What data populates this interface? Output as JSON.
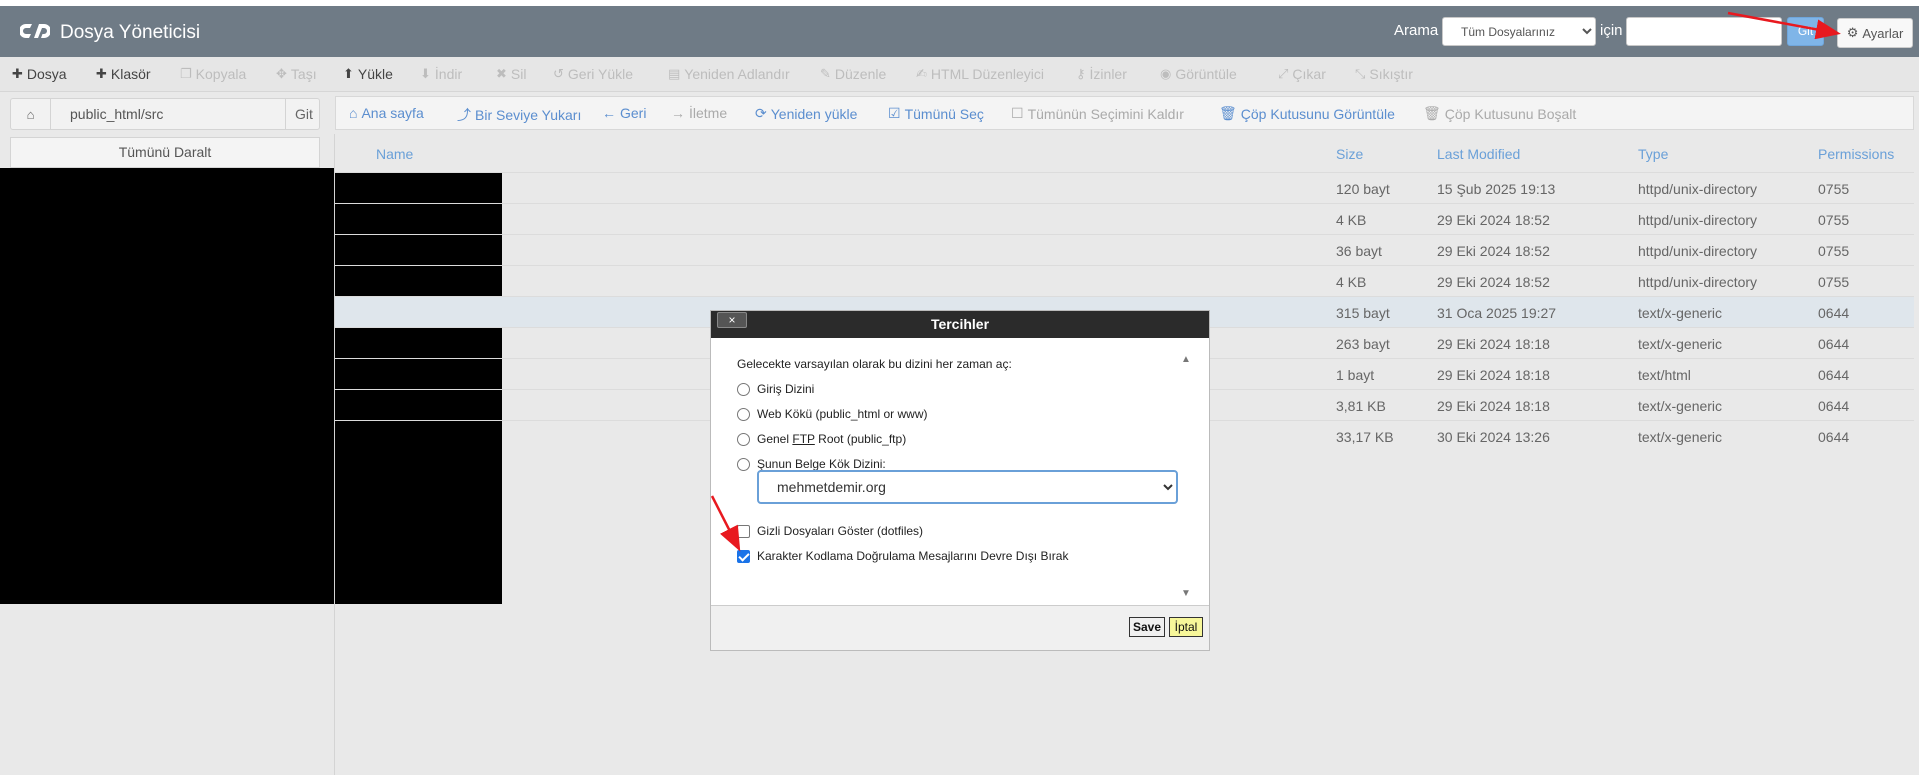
{
  "header": {
    "title": "Dosya Yöneticisi",
    "search_label": "Arama",
    "search_scope": "Tüm Dosyalarınız",
    "for_label": "için",
    "search_value": "",
    "go_label": "Git",
    "settings_label": "Ayarlar"
  },
  "toolbar": {
    "file": "Dosya",
    "folder": "Klasör",
    "copy": "Kopyala",
    "move": "Taşı",
    "upload": "Yükle",
    "download": "İndir",
    "delete": "Sil",
    "restore": "Geri Yükle",
    "rename": "Yeniden Adlandır",
    "edit": "Düzenle",
    "html_editor": "HTML Düzenleyici",
    "permissions": "İzinler",
    "view": "Görüntüle",
    "extract": "Çıkar",
    "compress": "Sıkıştır"
  },
  "sidebar": {
    "path": "public_html/src",
    "go_label": "Git",
    "collapse_all": "Tümünü Daralt"
  },
  "nav": {
    "home": "Ana sayfa",
    "up_one_level": "Bir Seviye Yukarı",
    "back": "Geri",
    "forward": "İletme",
    "reload": "Yeniden yükle",
    "select_all": "Tümünü Seç",
    "unselect_all": "Tümünün Seçimini Kaldır",
    "view_trash": "Çöp Kutusunu Görüntüle",
    "empty_trash": "Çöp Kutusunu Boşalt"
  },
  "table": {
    "headers": {
      "name": "Name",
      "size": "Size",
      "modified": "Last Modified",
      "type": "Type",
      "permissions": "Permissions"
    },
    "rows": [
      {
        "size": "120 bayt",
        "modified": "15 Şub 2025 19:13",
        "type": "httpd/unix-directory",
        "perms": "0755"
      },
      {
        "size": "4 KB",
        "modified": "29 Eki 2024 18:52",
        "type": "httpd/unix-directory",
        "perms": "0755"
      },
      {
        "size": "36 bayt",
        "modified": "29 Eki 2024 18:52",
        "type": "httpd/unix-directory",
        "perms": "0755"
      },
      {
        "size": "4 KB",
        "modified": "29 Eki 2024 18:52",
        "type": "httpd/unix-directory",
        "perms": "0755"
      },
      {
        "size": "315 bayt",
        "modified": "31 Oca 2025 19:27",
        "type": "text/x-generic",
        "perms": "0644"
      },
      {
        "size": "263 bayt",
        "modified": "29 Eki 2024 18:18",
        "type": "text/x-generic",
        "perms": "0644"
      },
      {
        "size": "1 bayt",
        "modified": "29 Eki 2024 18:18",
        "type": "text/html",
        "perms": "0644"
      },
      {
        "size": "3,81 KB",
        "modified": "29 Eki 2024 18:18",
        "type": "text/x-generic",
        "perms": "0644"
      },
      {
        "size": "33,17 KB",
        "modified": "30 Eki 2024 13:26",
        "type": "text/x-generic",
        "perms": "0644"
      }
    ]
  },
  "modal": {
    "title": "Tercihler",
    "close_label": "×",
    "intro": "Gelecekte varsayılan olarak bu dizini her zaman aç:",
    "options": {
      "home": "Giriş Dizini",
      "webroot": "Web Kökü (public_html or www)",
      "ftp_prefix": "Genel ",
      "ftp_abbr": "FTP",
      "ftp_suffix": " Root (public_ftp)",
      "docroot": "Şunun Belge Kök Dizini:"
    },
    "domain": "mehmetdemir.org",
    "show_hidden": "Gizli Dosyaları Göster (dotfiles)",
    "show_hidden_checked": false,
    "disable_encoding": "Karakter Kodlama Doğrulama Mesajlarını Devre Dışı Bırak",
    "disable_encoding_checked": true,
    "save_label": "Save",
    "cancel_label": "İptal"
  },
  "colors": {
    "header_bg": "#6f7b86",
    "link": "#5b8ecf",
    "annotation_arrow": "#e8191f"
  }
}
